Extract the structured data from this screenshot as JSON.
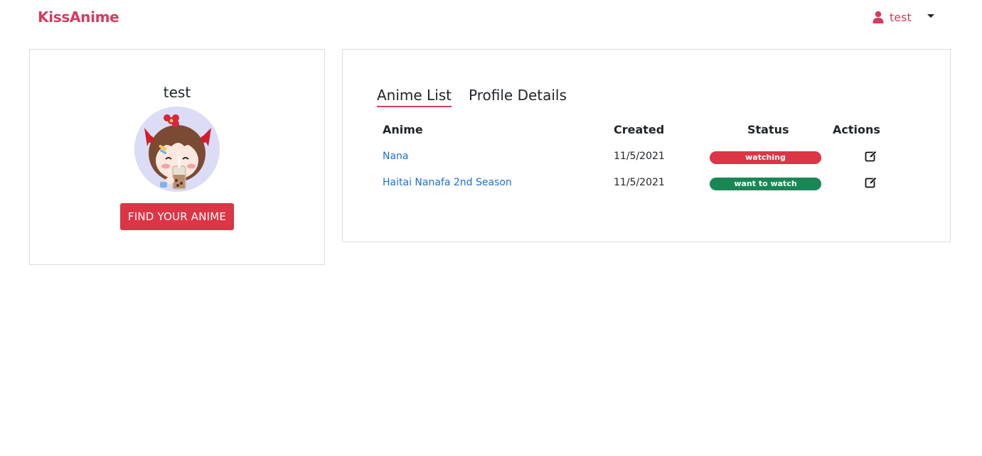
{
  "nav": {
    "brand": "KissAnime",
    "user": "test"
  },
  "profile": {
    "name": "test",
    "button": "FIND YOUR ANIME"
  },
  "tabs": [
    {
      "label": "Anime List"
    },
    {
      "label": "Profile Details"
    }
  ],
  "table": {
    "headers": [
      "Anime",
      "Created",
      "Status",
      "Actions"
    ],
    "rows": [
      {
        "anime": "Nana",
        "created": "11/5/2021",
        "status": "watching"
      },
      {
        "anime": "Haitai Nanafa 2nd Season",
        "created": "11/5/2021",
        "status": "want to watch"
      }
    ]
  },
  "colors": {
    "brand": "#d63c5e",
    "danger": "#dc3545",
    "success": "#198754",
    "link": "#1a6fd1"
  }
}
